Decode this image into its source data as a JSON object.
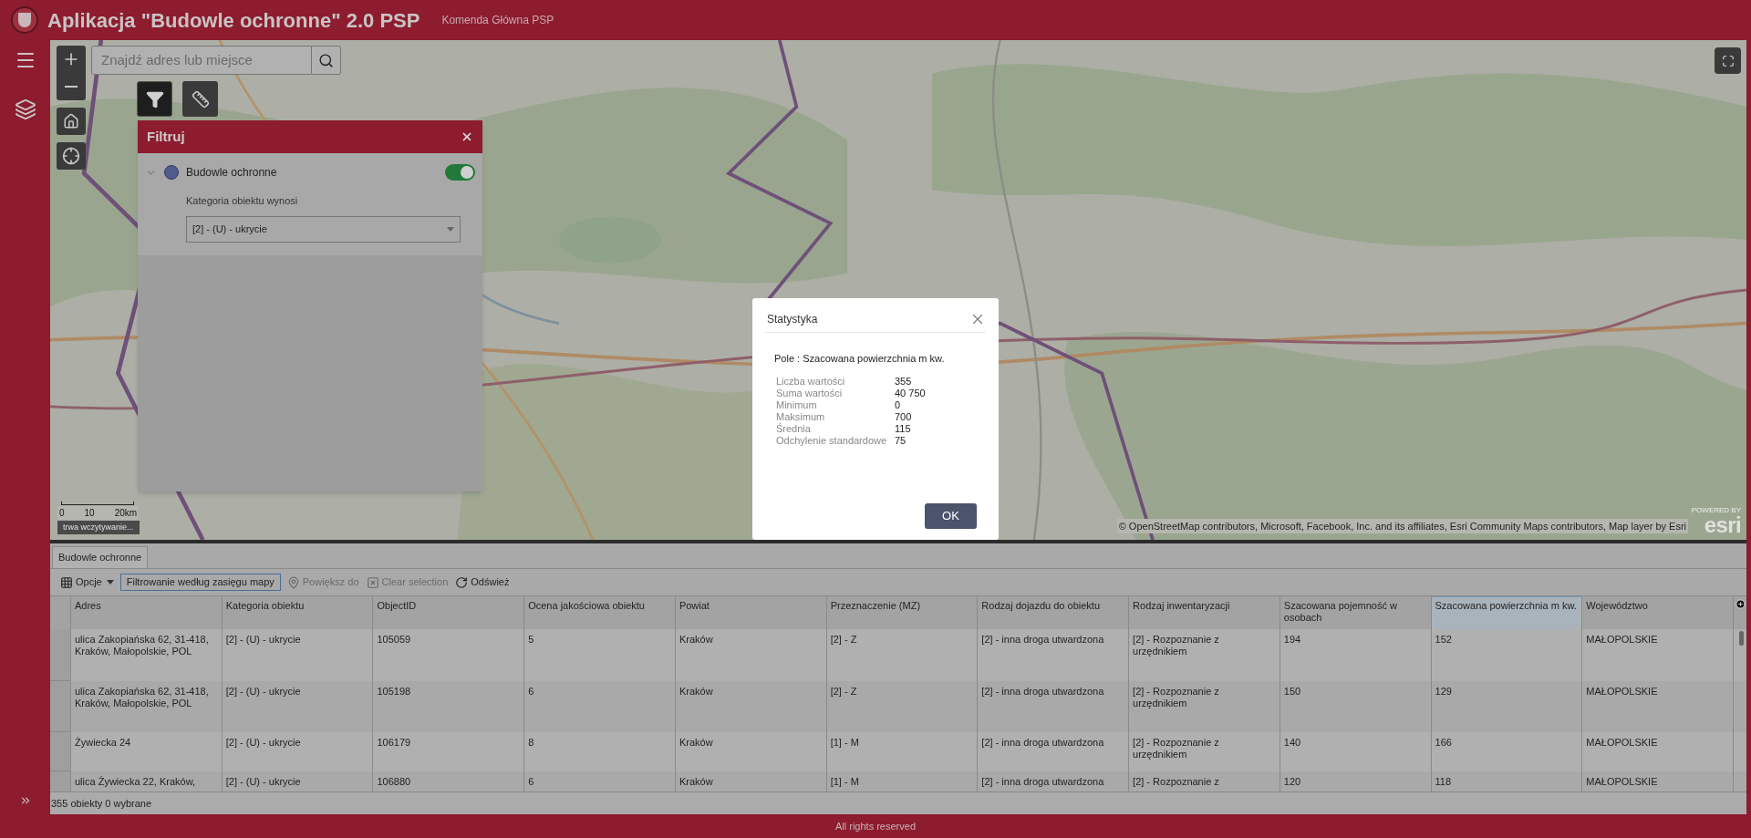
{
  "header": {
    "title": "Aplikacja \"Budowle ochronne\" 2.0 PSP",
    "subtitle": "Komenda Główna PSP"
  },
  "map": {
    "search": {
      "placeholder": "Znajdź adres lub miejsce"
    },
    "tools": [
      {
        "kind": "filter",
        "selected": true
      },
      {
        "kind": "measure",
        "selected": false
      }
    ],
    "scale_labels": [
      "0",
      "10",
      "20km"
    ],
    "loading": "trwa wczytywanie...",
    "attribution": "© OpenStreetMap contributors, Microsoft, Facebook, Inc. and its affiliates, Esri Community Maps contributors, Map layer by Esri",
    "esri": {
      "powered": "POWERED BY",
      "logo": "esri"
    }
  },
  "filter_panel": {
    "title": "Filtruj",
    "layer": {
      "name": "Budowle ochronne",
      "expanded": true,
      "on": true
    },
    "condition_label": "Kategoria obiektu wynosi",
    "value": "[2] - (U) - ukrycie"
  },
  "dialog": {
    "title": "Statystyka",
    "field": "Pole : Szacowana powierzchnia m kw.",
    "stats": [
      {
        "label": "Liczba wartości",
        "value": "355"
      },
      {
        "label": "Suma wartości",
        "value": "40 750"
      },
      {
        "label": "Minimum",
        "value": "0"
      },
      {
        "label": "Maksimum",
        "value": "700"
      },
      {
        "label": "Średnia",
        "value": "115"
      },
      {
        "label": "Odchylenie standardowe",
        "value": "75"
      }
    ],
    "button": "OK"
  },
  "table": {
    "tabs": [
      {
        "label": "Budowle ochronne",
        "selected": true
      }
    ],
    "toolbar": [
      {
        "kind": "menu",
        "label": "Opcje",
        "disabled": false
      },
      {
        "kind": "toggle",
        "label": "Filtrowanie według zasięgu mapy",
        "disabled": false
      },
      {
        "kind": "zoom",
        "label": "Powiększ do",
        "disabled": true
      },
      {
        "kind": "clear",
        "label": "Clear selection",
        "disabled": true
      },
      {
        "kind": "refresh",
        "label": "Odśwież",
        "disabled": false
      }
    ],
    "columns": [
      {
        "label": "Adres",
        "selected": false
      },
      {
        "label": "Kategoria obiektu",
        "selected": false
      },
      {
        "label": "ObjectID",
        "selected": false
      },
      {
        "label": "Ocena jakościowa obiektu",
        "selected": false
      },
      {
        "label": "Powiat",
        "selected": false
      },
      {
        "label": "Przeznaczenie (MZ)",
        "selected": false
      },
      {
        "label": "Rodzaj dojazdu do obiektu",
        "selected": false
      },
      {
        "label": "Rodzaj inwentaryzacji",
        "selected": false
      },
      {
        "label": "Szacowana pojemność w osobach",
        "selected": false
      },
      {
        "label": "Szacowana powierzchnia m kw.",
        "selected": true
      },
      {
        "label": "Województwo",
        "selected": false
      }
    ],
    "rows": [
      [
        "ulica Zakopiańska 62, 31-418, Kraków, Małopolskie, POL",
        "[2] - (U) - ukrycie",
        "105059",
        "5",
        "Kraków",
        "[2] - Z",
        "[2] - inna droga utwardzona",
        "[2] - Rozpoznanie z urzędnikiem",
        "194",
        "152",
        "MAŁOPOLSKIE"
      ],
      [
        "ulica Zakopiańska 62, 31-418, Kraków, Małopolskie, POL",
        "[2] - (U) - ukrycie",
        "105198",
        "6",
        "Kraków",
        "[2] - Z",
        "[2] - inna droga utwardzona",
        "[2] - Rozpoznanie z urzędnikiem",
        "150",
        "129",
        "MAŁOPOLSKIE"
      ],
      [
        "Żywiecka 24",
        "[2] - (U) - ukrycie",
        "106179",
        "8",
        "Kraków",
        "[1] - M",
        "[2] - inna droga utwardzona",
        "[2] - Rozpoznanie z urzędnikiem",
        "140",
        "166",
        "MAŁOPOLSKIE"
      ],
      [
        "ulica Żywiecka 22, Kraków,",
        "[2] - (U) - ukrycie",
        "106880",
        "6",
        "Kraków",
        "[1] - M",
        "[2] - inna droga utwardzona",
        "[2] - Rozpoznanie z",
        "120",
        "118",
        "MAŁOPOLSKIE"
      ]
    ],
    "status": "355 obiekty 0 wybrane"
  },
  "footer": "All rights reserved"
}
